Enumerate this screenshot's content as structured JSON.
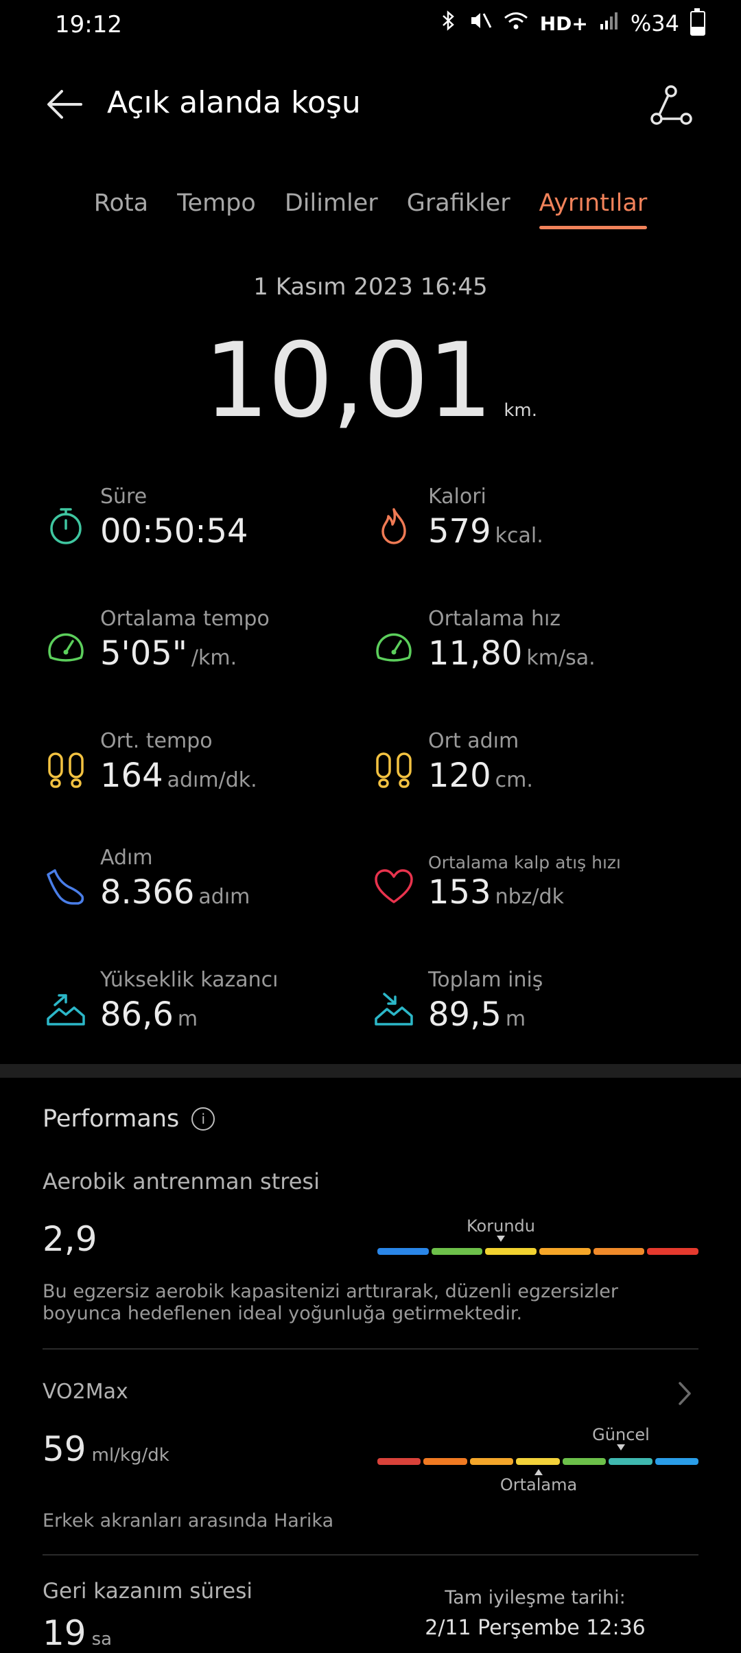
{
  "status_bar": {
    "time": "19:12",
    "network": "HD+",
    "battery": "%34",
    "battery_level": 34
  },
  "header": {
    "title": "Açık alanda koşu",
    "back_icon": "back-arrow-icon",
    "share_icon": "share-icon"
  },
  "tabs": [
    {
      "label": "Rota",
      "active": false
    },
    {
      "label": "Tempo",
      "active": false
    },
    {
      "label": "Dilimler",
      "active": false
    },
    {
      "label": "Grafikler",
      "active": false
    },
    {
      "label": "Ayrıntılar",
      "active": true
    }
  ],
  "summary": {
    "date": "1 Kasım 2023 16:45",
    "distance": "10,01",
    "distance_unit": "km."
  },
  "metrics": [
    {
      "label": "Süre",
      "value": "00:50:54",
      "unit": "",
      "icon": "stopwatch-icon",
      "color": "#3fc6a0"
    },
    {
      "label": "Kalori",
      "value": "579",
      "unit": "kcal.",
      "icon": "flame-icon",
      "color": "#ef7a54"
    },
    {
      "label": "Ortalama tempo",
      "value": "5'05\"",
      "unit": "/km.",
      "icon": "speedometer-icon",
      "color": "#5ccf5c"
    },
    {
      "label": "Ortalama hız",
      "value": "11,80",
      "unit": "km/sa.",
      "icon": "speedometer-icon",
      "color": "#5ccf5c"
    },
    {
      "label": "Ort. tempo",
      "value": "164",
      "unit": "adım/dk.",
      "icon": "footprints-icon",
      "color": "#f3c241"
    },
    {
      "label": "Ort adım",
      "value": "120",
      "unit": "cm.",
      "icon": "footprints-icon",
      "color": "#f3c241"
    },
    {
      "label": "Adım",
      "value": "8.366",
      "unit": "adım",
      "icon": "shoe-icon",
      "color": "#4a7ee8"
    },
    {
      "label": "Ortalama kalp atış hızı",
      "value": "153",
      "unit": "nbz/dk",
      "icon": "heart-icon",
      "color": "#e8334d"
    },
    {
      "label": "Yükseklik kazancı",
      "value": "86,6",
      "unit": "m",
      "icon": "elevation-gain-icon",
      "color": "#2cb7c8"
    },
    {
      "label": "Toplam iniş",
      "value": "89,5",
      "unit": "m",
      "icon": "elevation-loss-icon",
      "color": "#2cb7c8"
    }
  ],
  "performance": {
    "title": "Performans",
    "aerobic": {
      "label": "Aerobik antrenman stresi",
      "value": "2,9",
      "marker_label": "Korundu",
      "description": "Bu egzersiz aerobik kapasitenizi arttırarak, düzenli egzersizler boyunca hedeflenen ideal yoğunluğa getirmektedir.",
      "scale_colors": [
        "#2a86e8",
        "#6dc04a",
        "#f2d230",
        "#f6a628",
        "#f08a2a",
        "#e53a2e"
      ]
    },
    "vo2max": {
      "label": "VO2Max",
      "value": "59",
      "unit": "ml/kg/dk",
      "current_label": "Güncel",
      "average_label": "Ortalama",
      "description": "Erkek akranları arasında Harika",
      "scale_colors": [
        "#d9423a",
        "#f07a22",
        "#f4a62a",
        "#f3d23a",
        "#6cc04a",
        "#3fb8b0",
        "#2a9de8"
      ]
    },
    "recovery": {
      "label": "Geri kazanım süresi",
      "value": "19",
      "unit": "sa",
      "full_recovery_label": "Tam iyileşme tarihi:",
      "full_recovery_date": "2/11 Perşembe 12:36"
    }
  }
}
